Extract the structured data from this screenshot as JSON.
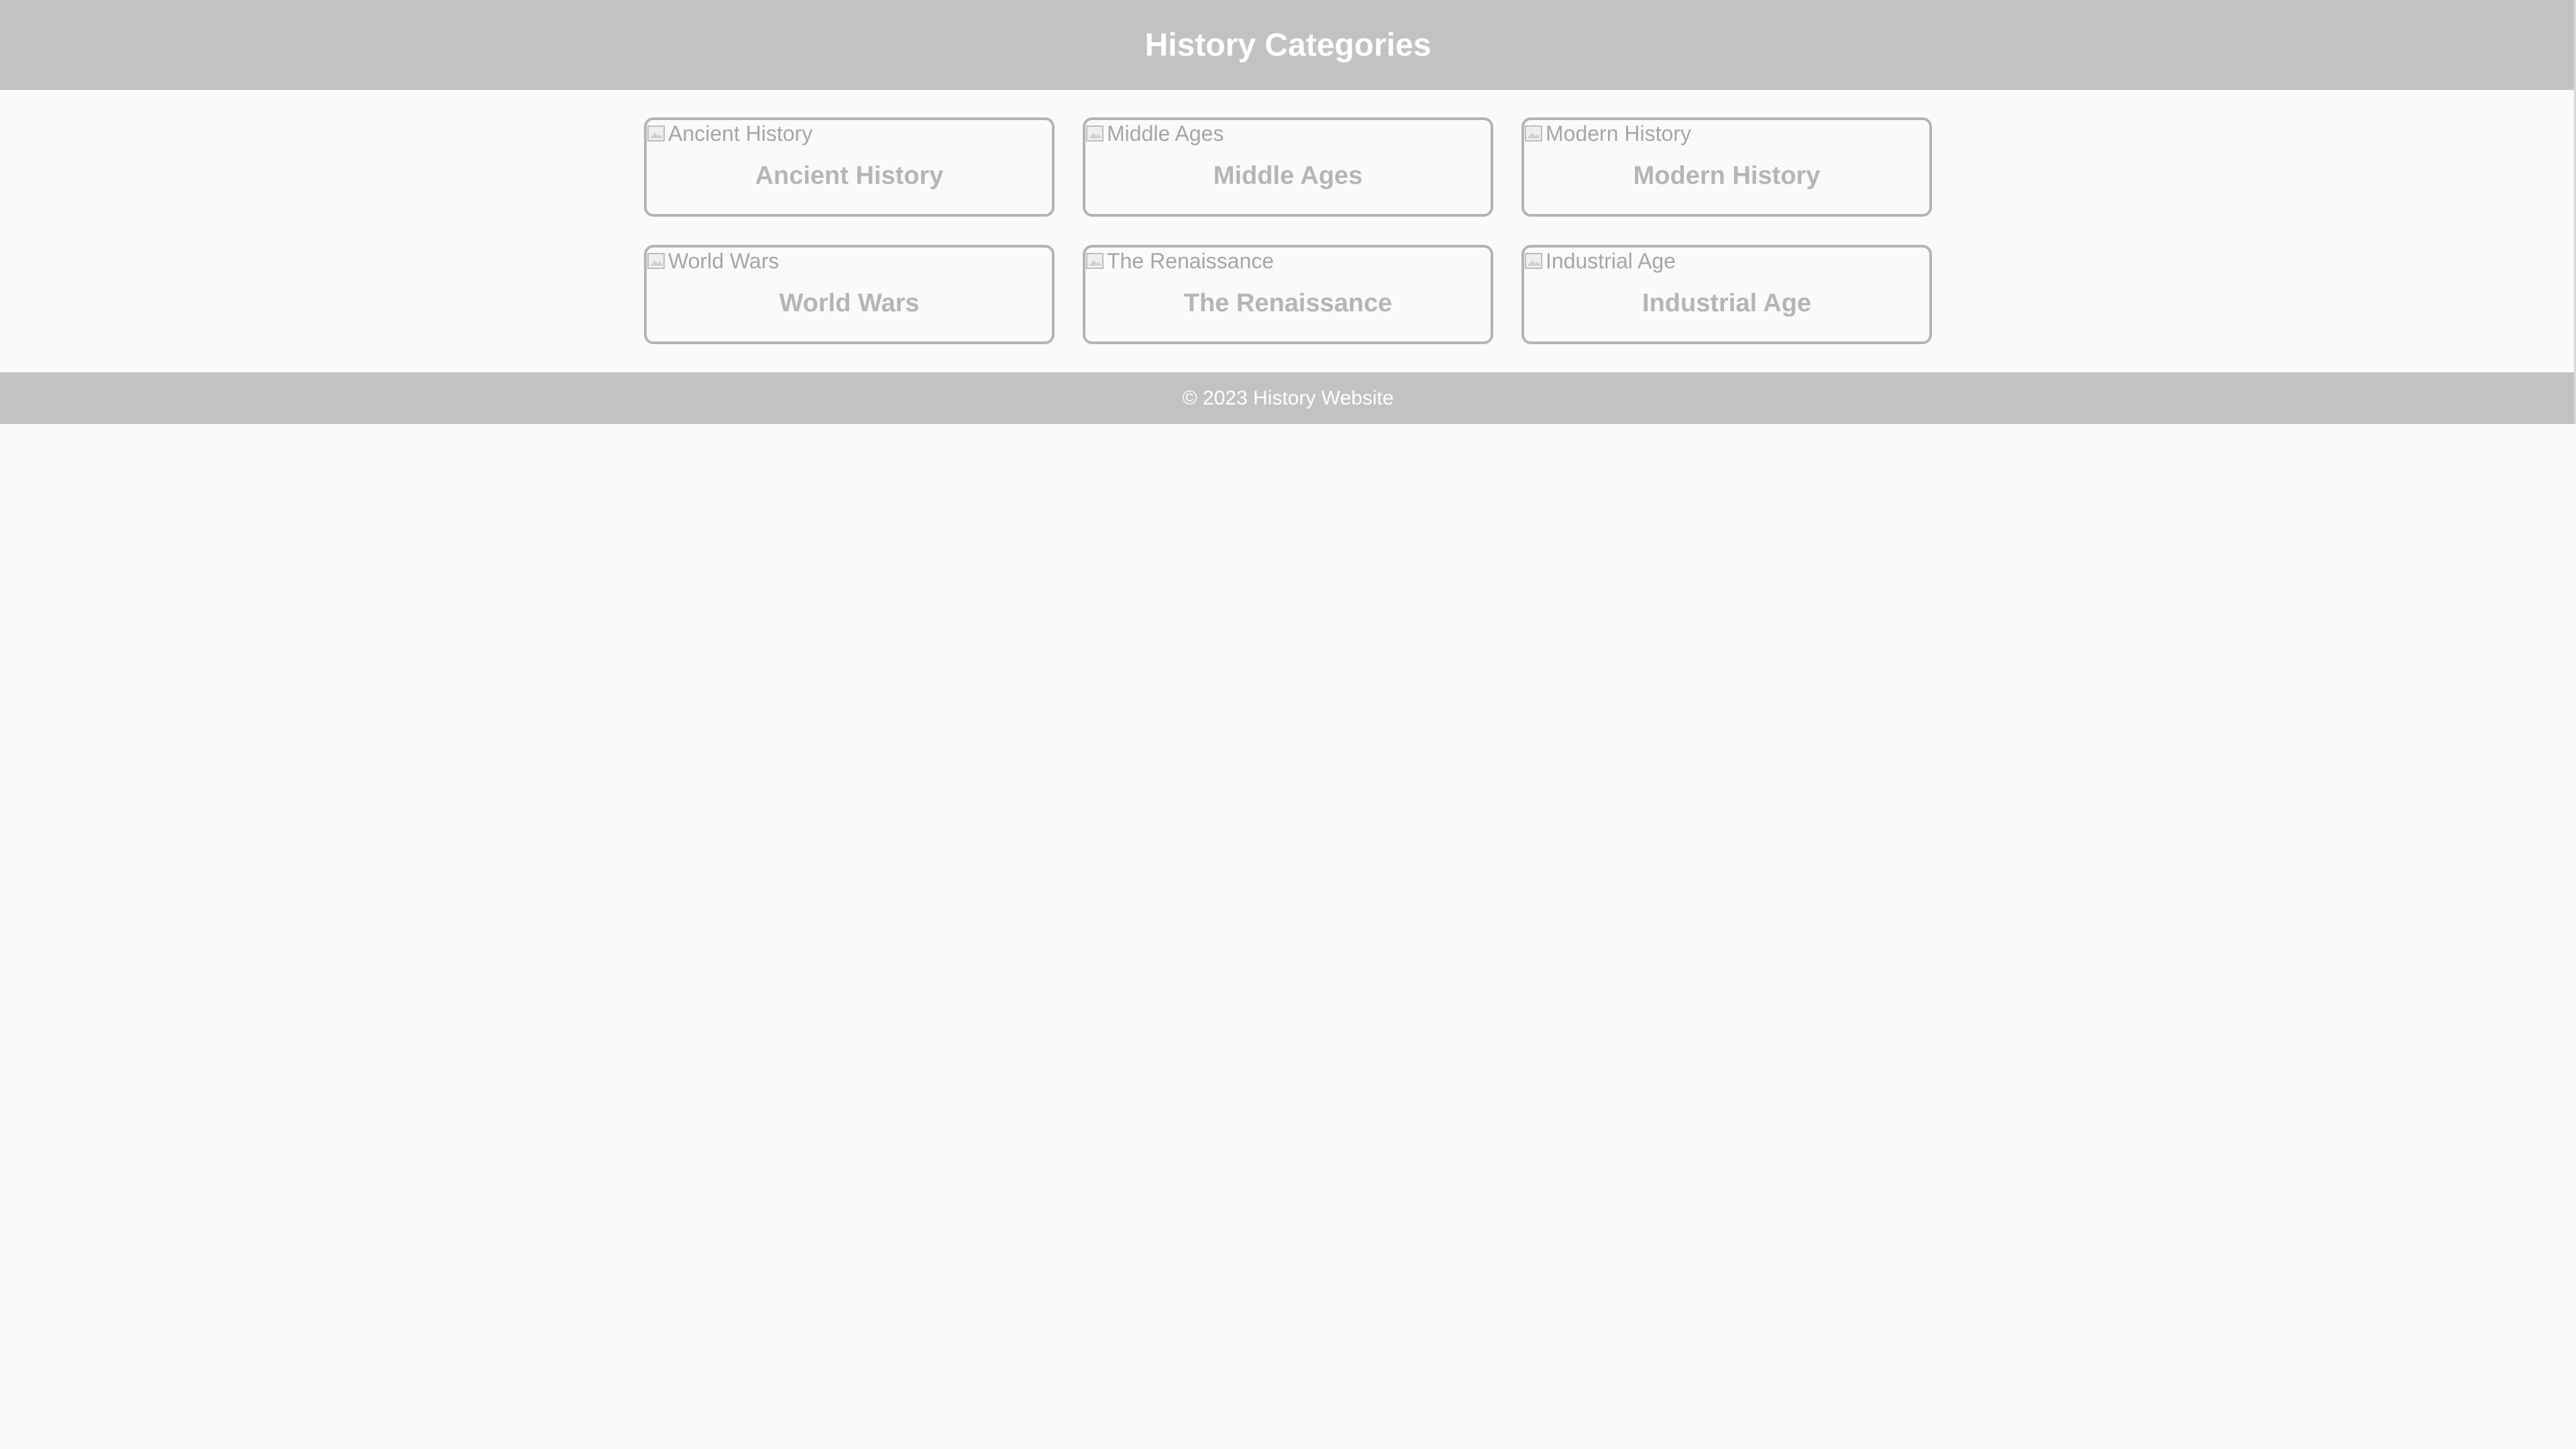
{
  "header": {
    "title": "History Categories"
  },
  "categories": [
    {
      "alt": "Ancient History",
      "label": "Ancient History"
    },
    {
      "alt": "Middle Ages",
      "label": "Middle Ages"
    },
    {
      "alt": "Modern History",
      "label": "Modern History"
    },
    {
      "alt": "World Wars",
      "label": "World Wars"
    },
    {
      "alt": "The Renaissance",
      "label": "The Renaissance"
    },
    {
      "alt": "Industrial Age",
      "label": "Industrial Age"
    }
  ],
  "footer": {
    "text": "© 2023 History Website"
  },
  "colors": {
    "bar_background": "#c2c2c2",
    "page_background": "#fafafa",
    "card_border": "#b3b3b3",
    "card_label": "#b5b5b5",
    "alt_text": "#a6a6a6"
  },
  "icons": {
    "image_placeholder": "broken-image-icon"
  }
}
